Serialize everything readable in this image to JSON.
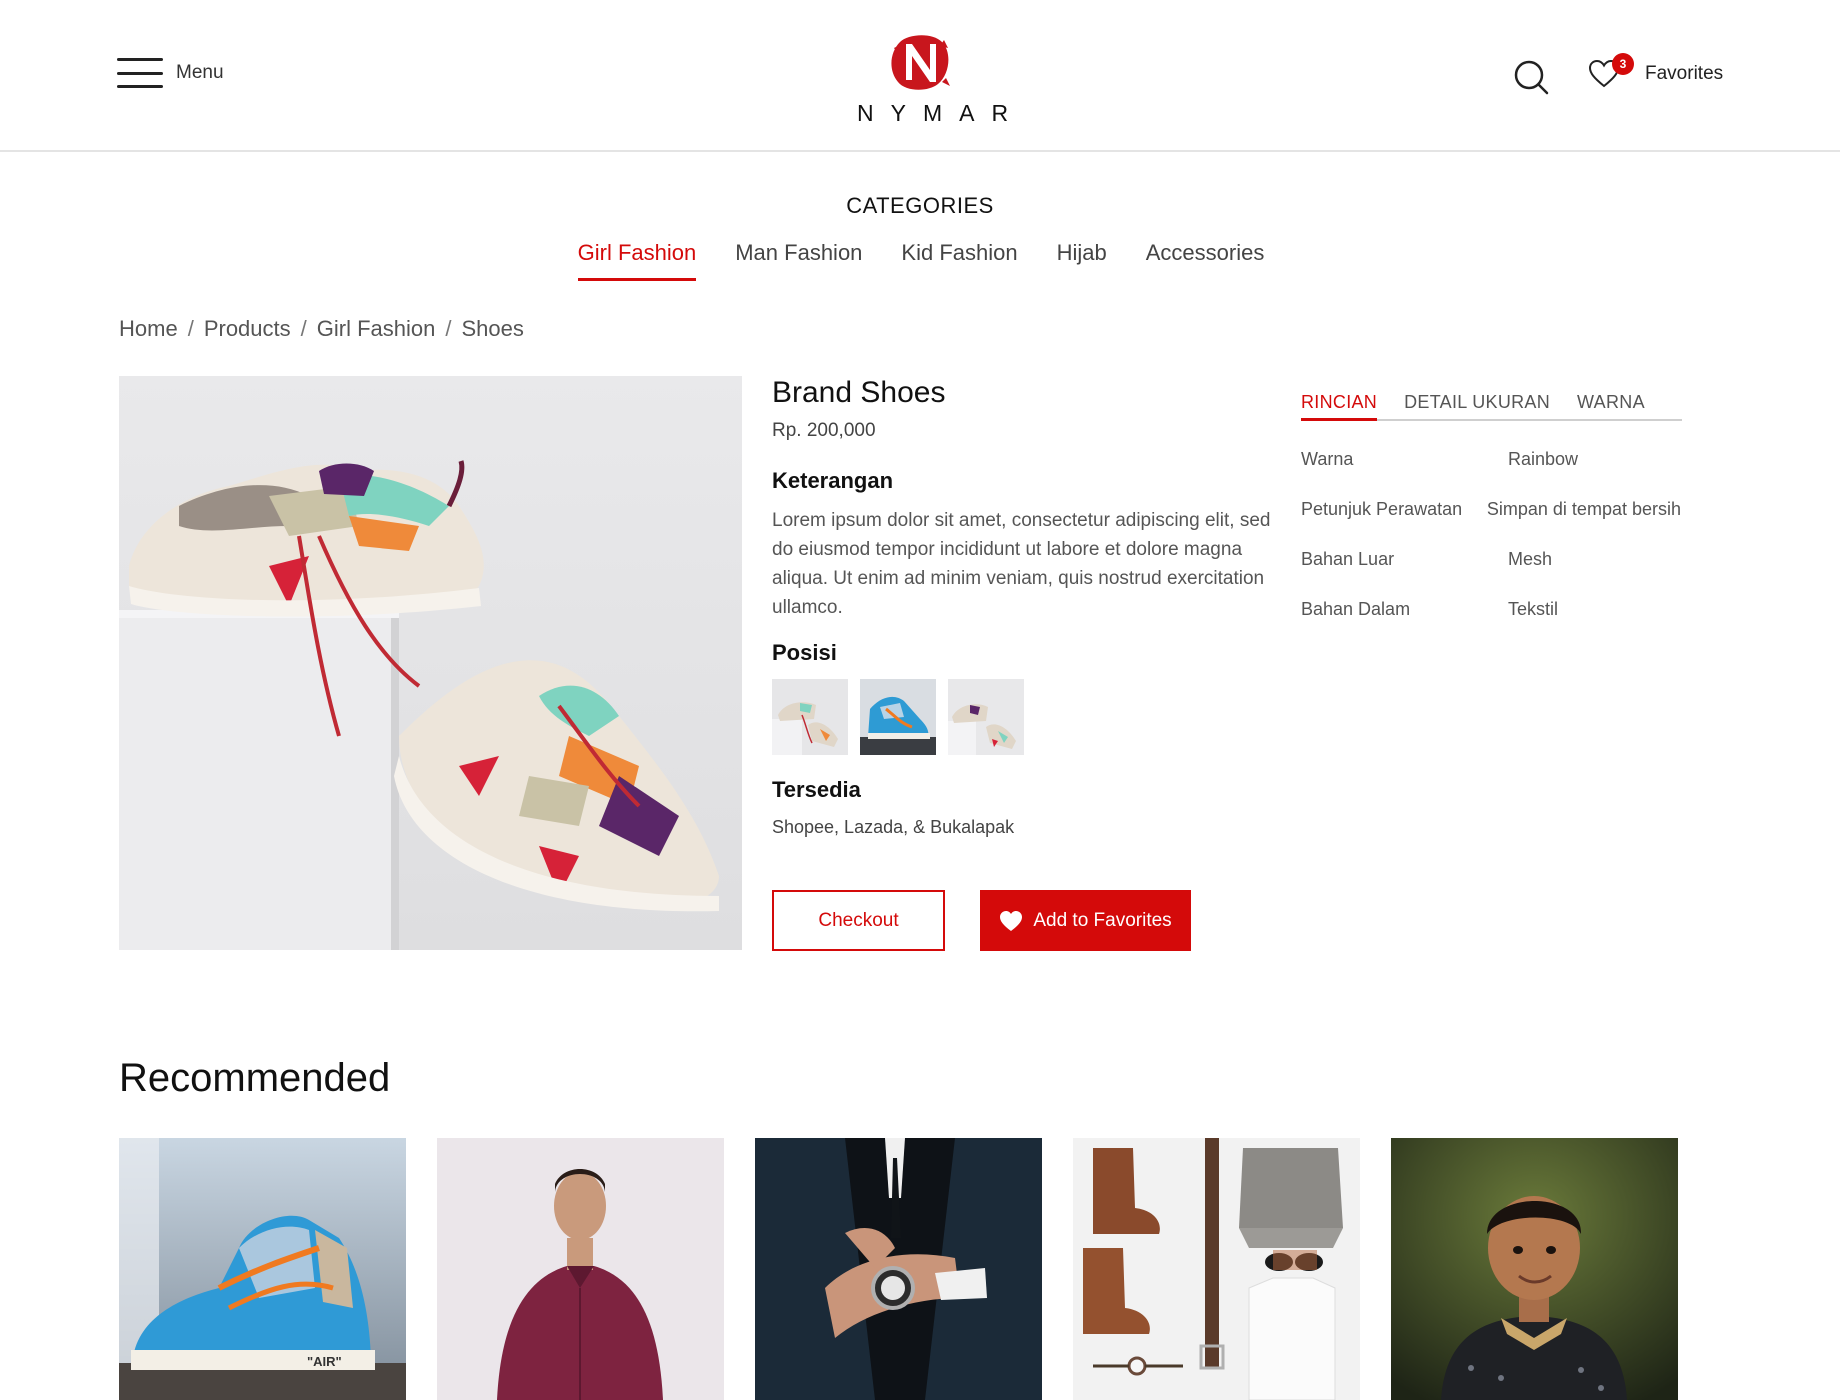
{
  "header": {
    "menu_label": "Menu",
    "logo_text": "NYMAR",
    "favorites_label": "Favorites",
    "favorites_count": "3"
  },
  "categories": {
    "title": "CATEGORIES",
    "tabs": [
      {
        "label": "Girl Fashion",
        "active": true
      },
      {
        "label": "Man Fashion",
        "active": false
      },
      {
        "label": "Kid Fashion",
        "active": false
      },
      {
        "label": "Hijab",
        "active": false
      },
      {
        "label": "Accessories",
        "active": false
      }
    ]
  },
  "breadcrumb": [
    "Home",
    "Products",
    "Girl Fashion",
    "Shoes"
  ],
  "product": {
    "title": "Brand Shoes",
    "price": "Rp. 200,000",
    "description_heading": "Keterangan",
    "description": "Lorem ipsum dolor sit amet, consectetur adipiscing elit, sed do eiusmod tempor incididunt ut labore et dolore magna aliqua. Ut enim ad minim veniam, quis nostrud exercitation ullamco.",
    "position_heading": "Posisi",
    "available_heading": "Tersedia",
    "available": "Shopee, Lazada, & Bukalapak",
    "checkout_label": "Checkout",
    "add_favorites_label": "Add to Favorites"
  },
  "detail": {
    "tabs": [
      {
        "label": "RINCIAN",
        "active": true
      },
      {
        "label": "DETAIL UKURAN",
        "active": false
      },
      {
        "label": "WARNA",
        "active": false
      }
    ],
    "specs": [
      {
        "key": "Warna",
        "value": "Rainbow"
      },
      {
        "key": "Petunjuk Perawatan",
        "value": "Simpan di tempat bersih"
      },
      {
        "key": "Bahan Luar",
        "value": "Mesh"
      },
      {
        "key": "Bahan Dalam",
        "value": "Tekstil"
      }
    ]
  },
  "recommended": {
    "title": "Recommended",
    "items": [
      "sneaker",
      "man-shirt",
      "watch",
      "flat-lay",
      "kid"
    ]
  },
  "colors": {
    "accent": "#d40a0a",
    "text": "#222222",
    "muted": "#555555"
  }
}
